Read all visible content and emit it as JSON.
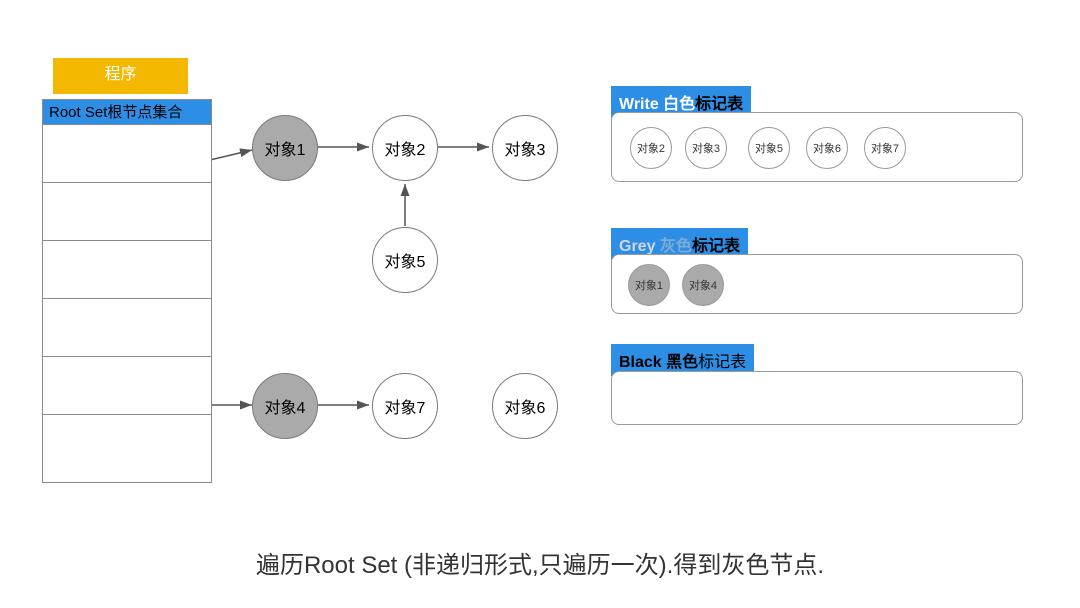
{
  "left": {
    "program_label": "程序",
    "rootset_label": "Root Set根节点集合"
  },
  "objects": {
    "o1": "对象1",
    "o2": "对象2",
    "o3": "对象3",
    "o4": "对象4",
    "o5": "对象5",
    "o6": "对象6",
    "o7": "对象7"
  },
  "white": {
    "header_a": "Write 白色",
    "header_b": "标记表",
    "items": {
      "m1": "对象2",
      "m2": "对象3",
      "m3": "对象5",
      "m4": "对象6",
      "m5": "对象7"
    }
  },
  "grey": {
    "header_a": "Grey ",
    "header_b": "灰色",
    "header_c": "标记表",
    "items": {
      "m1": "对象1",
      "m2": "对象4"
    }
  },
  "black": {
    "header_a": "Black 黑色",
    "header_b": "标记表"
  },
  "caption": "遍历Root Set (非递归形式,只遍历一次).得到灰色节点."
}
